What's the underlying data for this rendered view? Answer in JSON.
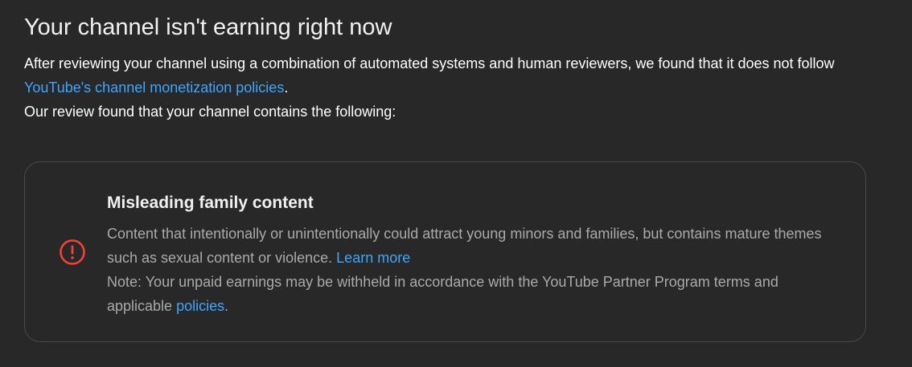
{
  "page": {
    "title": "Your channel isn't earning right now",
    "intro_line1_prefix": "After reviewing your channel using a combination of automated systems and human reviewers, we found that it does not follow ",
    "intro_link": "YouTube's channel monetization policies",
    "intro_line1_suffix": ".",
    "intro_line2": "Our review found that your channel contains the following:"
  },
  "card": {
    "icon": "error-circle-icon",
    "icon_color": "#f44336",
    "title": "Misleading family content",
    "description": "Content that intentionally or unintentionally could attract young minors and families, but contains mature themes such as sexual content or violence. ",
    "learn_more_link": "Learn more",
    "note_prefix": "Note: Your unpaid earnings may be withheld in accordance with the YouTube Partner Program terms and applicable ",
    "policies_link": "policies",
    "note_suffix": "."
  },
  "colors": {
    "background": "#282828",
    "link": "#3ea6ff",
    "text_primary": "#f1f1f1",
    "text_secondary": "#aaaaaa"
  }
}
